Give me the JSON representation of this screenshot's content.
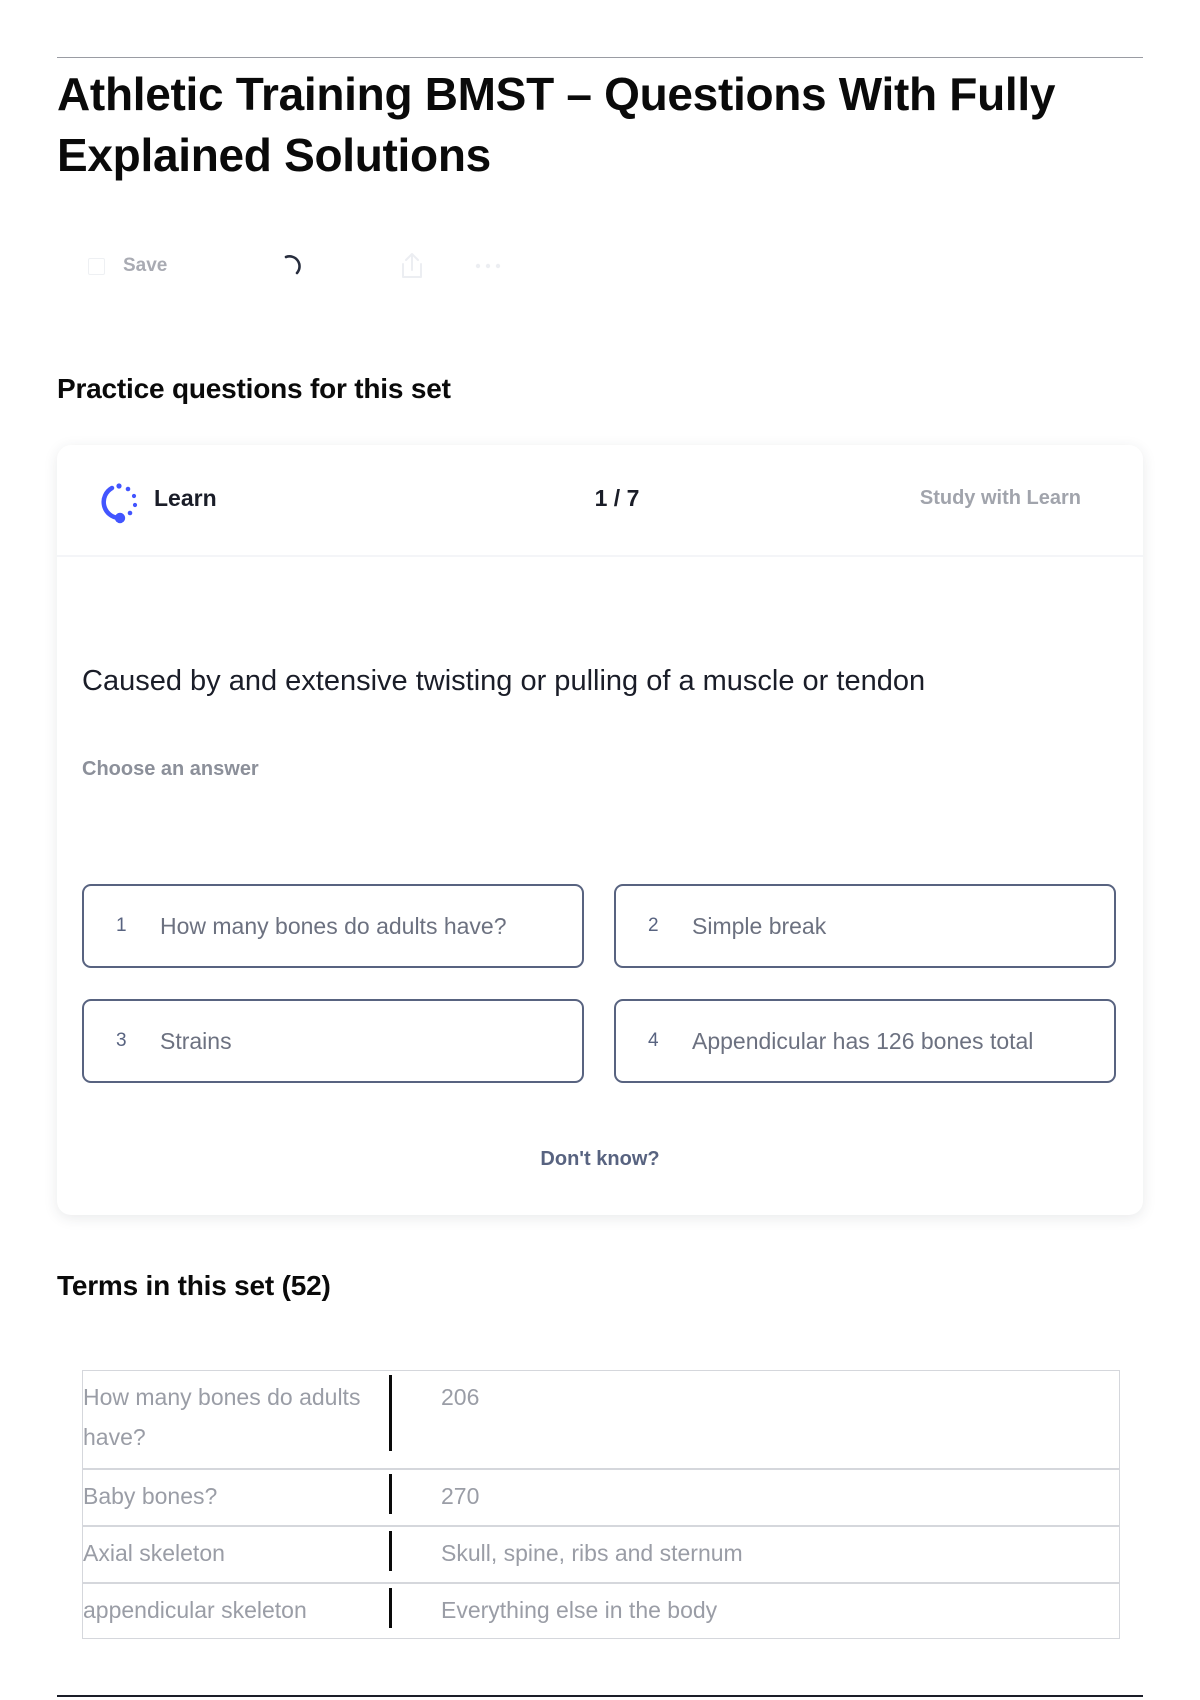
{
  "page": {
    "title": "Athletic Training BMST – Questions With Fully Explained Solutions"
  },
  "toolbar": {
    "save_label": "Save",
    "icons": [
      "checkbox-icon",
      "loading-spinner-icon",
      "share-icon",
      "more-icon"
    ]
  },
  "practice": {
    "heading": "Practice questions for this set"
  },
  "learn_card": {
    "mode_label": "Learn",
    "progress": "1 / 7",
    "study_link": "Study with Learn",
    "question": "Caused by and extensive twisting or pulling of a muscle or tendon",
    "choose_label": "Choose an answer",
    "options": [
      {
        "number": "1",
        "text": "How many bones do adults have?"
      },
      {
        "number": "2",
        "text": "Simple break"
      },
      {
        "number": "3",
        "text": "Strains"
      },
      {
        "number": "4",
        "text": "Appendicular has 126 bones total"
      }
    ],
    "dont_know": "Don't know?",
    "accent_color": "#4255ff"
  },
  "terms": {
    "heading": "Terms in this set (52)",
    "rows": [
      {
        "term": "How many bones do adults have?",
        "definition": "206"
      },
      {
        "term": "Baby bones?",
        "definition": "270"
      },
      {
        "term": "Axial skeleton",
        "definition": "Skull, spine, ribs and sternum"
      },
      {
        "term": "appendicular skeleton",
        "definition": "Everything else in the body"
      }
    ]
  }
}
